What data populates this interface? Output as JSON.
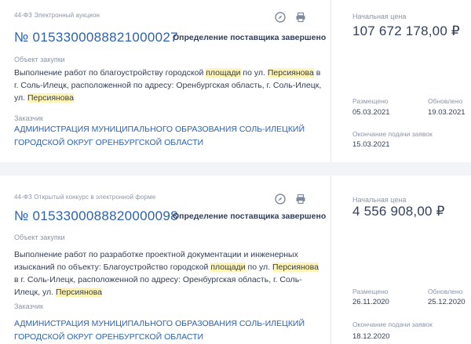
{
  "cards": [
    {
      "law_type": "44-ФЗ Электронный аукцион",
      "reg_number": "№ 0153300088821000027",
      "stage": "Определение поставщика завершено",
      "object_label": "Объект закупки",
      "object_parts": [
        "Выполнение работ по благоустройству городской ",
        "площади",
        " по ул. ",
        "Персиянова",
        " в г. Соль-Илецк, расположенной по адресу: Оренбургская область, г. Соль-Илецк, ул. ",
        "Персиянова"
      ],
      "customer_label": "Заказчик",
      "customer": "АДМИНИСТРАЦИЯ МУНИЦИПАЛЬНОГО ОБРАЗОВАНИЯ СОЛЬ-ИЛЕЦКИЙ ГОРОДСКОЙ ОКРУГ ОРЕНБУРГСКОЙ ОБЛАСТИ",
      "price_label": "Начальная цена",
      "price": "107 672 178,00 ₽",
      "posted_label": "Размещено",
      "posted": "05.03.2021",
      "updated_label": "Обновлено",
      "updated": "19.03.2021",
      "deadline_label": "Окончание подачи заявок",
      "deadline": "15.03.2021"
    },
    {
      "law_type": "44-ФЗ Открытый конкурс в электронной форме",
      "reg_number": "№ 0153300088820000098",
      "stage": "Определение поставщика завершено",
      "object_label": "Объект закупки",
      "object_parts": [
        "Выполнение работ по разработке проектной документации и инженерных изысканий по объекту: Благоустройство городской ",
        "площади",
        " по ул. ",
        "Персиянова",
        " в г. Соль-Илецк, расположенной по адресу: Оренбургская область, г. Соль-Илецк, ул. ",
        "Персиянова"
      ],
      "customer_label": "Заказчик",
      "customer": "АДМИНИСТРАЦИЯ МУНИЦИПАЛЬНОГО ОБРАЗОВАНИЯ СОЛЬ-ИЛЕЦКИЙ ГОРОДСКОЙ ОКРУГ ОРЕНБУРГСКОЙ ОБЛАСТИ",
      "price_label": "Начальная цена",
      "price": "4 556 908,00 ₽",
      "posted_label": "Размещено",
      "posted": "26.11.2020",
      "updated_label": "Обновлено",
      "updated": "25.12.2020",
      "deadline_label": "Окончание подачи заявок",
      "deadline": "18.12.2020"
    }
  ],
  "icons": {
    "route": "compass-icon",
    "print": "print-icon"
  },
  "colors": {
    "link": "#2d62b0",
    "highlight": "#fff4b8",
    "muted": "#8a95a8",
    "text": "#334059"
  }
}
